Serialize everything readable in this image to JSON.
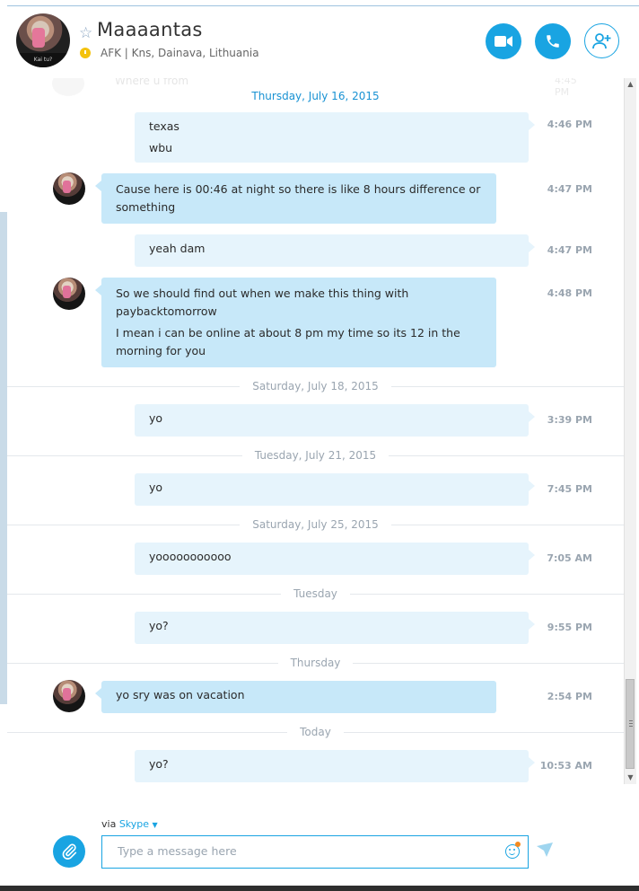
{
  "header": {
    "contact_name": "Maaaantas",
    "status_text": "AFK | Kns, Dainava, Lithuania",
    "avatar_caption": "Kai tu?",
    "buttons": {
      "video_call": "video-call",
      "audio_call": "audio-call",
      "add_people": "add-people"
    }
  },
  "faded_message": {
    "text": "Where u from",
    "time": "4:45 PM"
  },
  "dates": {
    "d1": "Thursday, July 16, 2015",
    "d2": "Saturday, July 18, 2015",
    "d3": "Tuesday, July 21, 2015",
    "d4": "Saturday, July 25, 2015",
    "d5": "Tuesday",
    "d6": "Thursday",
    "d7": "Today"
  },
  "messages": [
    {
      "from": "me",
      "lines": [
        "texas",
        "wbu"
      ],
      "time": "4:46 PM"
    },
    {
      "from": "contact",
      "lines": [
        "Cause here is 00:46  at night so there is like 8 hours difference or something"
      ],
      "time": "4:47 PM"
    },
    {
      "from": "me",
      "lines": [
        "yeah dam"
      ],
      "time": "4:47 PM"
    },
    {
      "from": "contact",
      "lines": [
        "So we should find out when we make this thing with paybacktomorrow",
        "I mean i can be online at about 8 pm my time so its 12 in the morning for you"
      ],
      "time": "4:48 PM"
    },
    {
      "from": "me",
      "lines": [
        "yo"
      ],
      "time": "3:39 PM"
    },
    {
      "from": "me",
      "lines": [
        "yo"
      ],
      "time": "7:45 PM"
    },
    {
      "from": "me",
      "lines": [
        "yooooooooooo"
      ],
      "time": "7:05 AM"
    },
    {
      "from": "me",
      "lines": [
        "yo?"
      ],
      "time": "9:55 PM"
    },
    {
      "from": "contact",
      "lines": [
        "yo sry was on vacation"
      ],
      "time": "2:54 PM"
    },
    {
      "from": "me",
      "lines": [
        "yo?"
      ],
      "time": "10:53 AM"
    }
  ],
  "footer": {
    "via_label": "via",
    "via_service": "Skype",
    "input_placeholder": "Type a message here",
    "input_value": ""
  },
  "colors": {
    "accent": "#19a4e2",
    "incoming_bubble": "#c7e8f9",
    "outgoing_bubble": "#e6f4fc",
    "status_away": "#f4c20d"
  }
}
